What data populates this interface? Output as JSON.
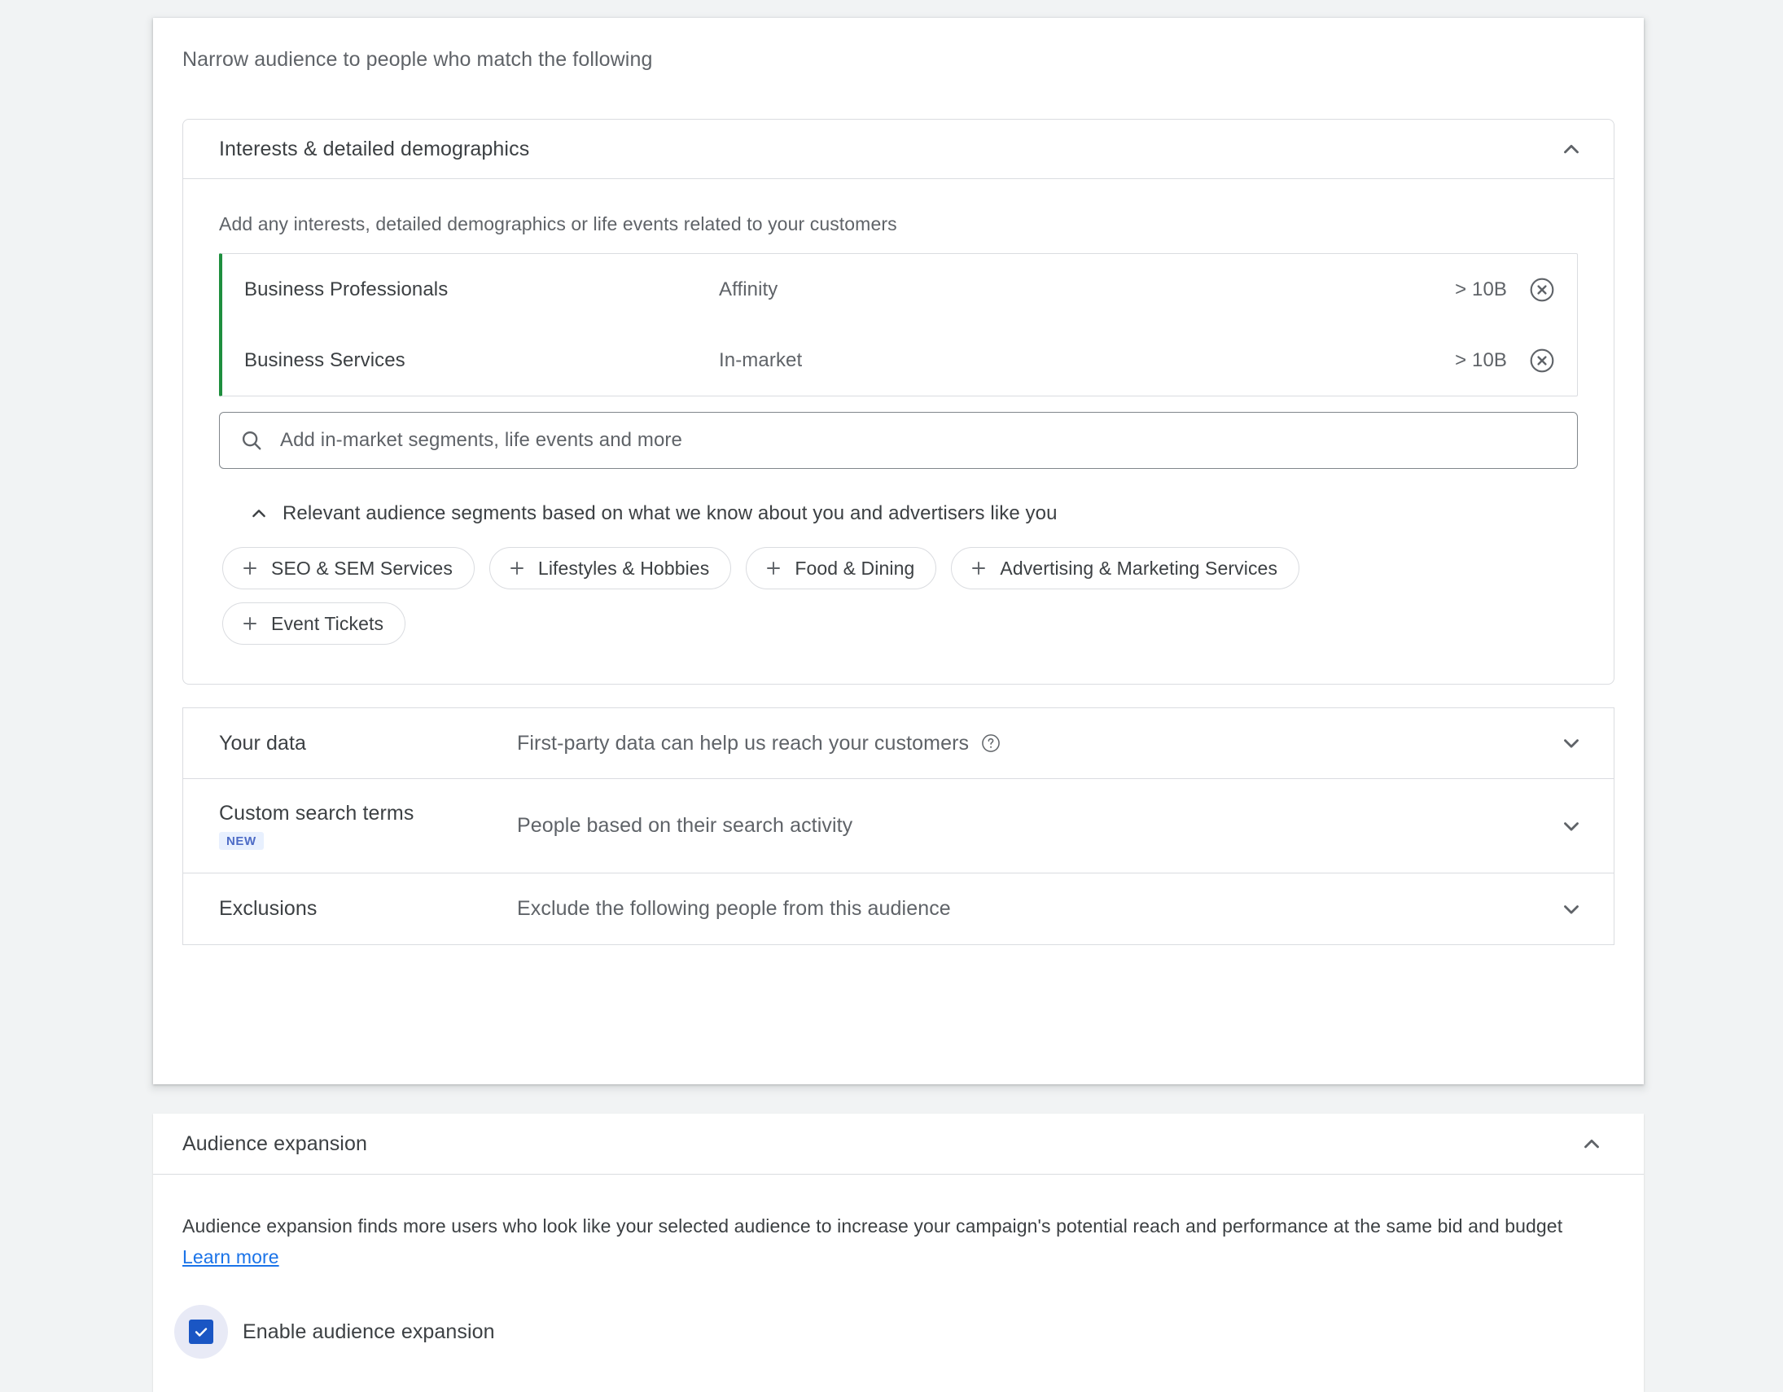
{
  "narrow": {
    "caption": "Narrow audience to people who match the following"
  },
  "interests": {
    "title": "Interests & detailed demographics",
    "collapse_icon": "chevron-up-icon",
    "hint": "Add any interests, detailed demographics or life events related to your customers",
    "selected": [
      {
        "name": "Business Professionals",
        "type": "Affinity",
        "size": "> 10B",
        "remove_icon": "close-circle-icon"
      },
      {
        "name": "Business Services",
        "type": "In-market",
        "size": "> 10B",
        "remove_icon": "close-circle-icon"
      }
    ],
    "search": {
      "placeholder": "Add in-market segments, life events and more",
      "value": "",
      "icon": "search-icon"
    },
    "relevant": {
      "label": "Relevant audience segments based on what we know about you and advertisers like you",
      "icon": "chevron-up-icon"
    },
    "suggestions": [
      {
        "label": "SEO & SEM Services",
        "icon": "plus-icon"
      },
      {
        "label": "Lifestyles & Hobbies",
        "icon": "plus-icon"
      },
      {
        "label": "Food & Dining",
        "icon": "plus-icon"
      },
      {
        "label": "Advertising & Marketing Services",
        "icon": "plus-icon"
      },
      {
        "label": "Event Tickets",
        "icon": "plus-icon"
      }
    ]
  },
  "collapsed_sections": [
    {
      "title": "Your data",
      "description": "First-party data can help us reach your customers",
      "help_icon": "help-circle-icon",
      "expand_icon": "chevron-down-icon"
    },
    {
      "title": "Custom search terms",
      "badge": "NEW",
      "description": "People based on their search activity",
      "expand_icon": "chevron-down-icon"
    },
    {
      "title": "Exclusions",
      "description": "Exclude the following people from this audience",
      "expand_icon": "chevron-down-icon"
    }
  ],
  "audience_expansion": {
    "title": "Audience expansion",
    "collapse_icon": "chevron-up-icon",
    "description": "Audience expansion finds more users who look like your selected audience to increase your campaign's potential reach and performance at the same bid and budget",
    "learn_more": "Learn more",
    "checkbox": {
      "label": "Enable audience expansion",
      "checked": true
    }
  },
  "colors": {
    "page_background": "#f1f3f4",
    "card_background": "#ffffff",
    "border": "#dadce0",
    "text_primary": "#3c4043",
    "text_secondary": "#5f6368",
    "accent_link": "#1a73e8",
    "selected_marker_green": "#1e8e3e",
    "checkbox_blue": "#1a56c4",
    "badge_background": "#e8f0fe",
    "badge_text": "#4d6bc6"
  }
}
